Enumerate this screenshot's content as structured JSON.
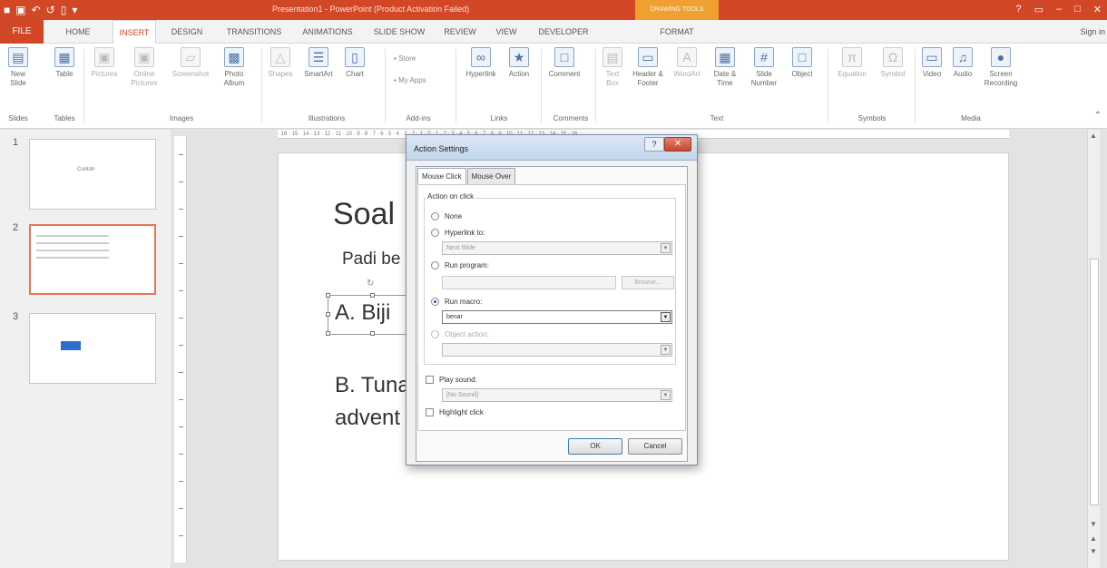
{
  "titlebar": {
    "qat_icons": [
      "powerpoint-logo",
      "save",
      "undo",
      "redo",
      "present-from-start",
      "customize"
    ],
    "title": "Presentation1 - PowerPoint (Product Activation Failed)",
    "context_group": "DRAWING TOOLS",
    "window_controls": [
      "?",
      "▭",
      "–",
      "□",
      "✕"
    ]
  },
  "tabs": {
    "file": "FILE",
    "items": [
      "HOME",
      "INSERT",
      "DESIGN",
      "TRANSITIONS",
      "ANIMATIONS",
      "SLIDE SHOW",
      "REVIEW",
      "VIEW",
      "DEVELOPER",
      "FORMAT"
    ],
    "active": "INSERT",
    "signin": "Sign in"
  },
  "ribbon": {
    "groups": {
      "slides": "Slides",
      "tables": "Tables",
      "images": "Images",
      "illustrations": "Illustrations",
      "addins": "Add-ins",
      "links": "Links",
      "comments": "Comments",
      "text": "Text",
      "symbols": "Symbols",
      "media": "Media"
    },
    "buttons": {
      "new_slide": "New Slide",
      "table": "Table",
      "pictures": "Pictures",
      "online_pictures": "Online Pictures",
      "screenshot": "Screenshot",
      "photo_album": "Photo Album",
      "shapes": "Shapes",
      "smartart": "SmartArt",
      "chart": "Chart",
      "store": "Store",
      "my_apps": "My Apps",
      "hyperlink": "Hyperlink",
      "action": "Action",
      "comment": "Comment",
      "text_box": "Text Box",
      "header_footer": "Header & Footer",
      "wordart": "WordArt",
      "date_time": "Date & Time",
      "slide_number": "Slide Number",
      "object": "Object",
      "equation": "Equation",
      "symbol": "Symbol",
      "video": "Video",
      "audio": "Audio",
      "screen_recording": "Screen Recording"
    }
  },
  "ruler": {
    "h_ticks": "· 16 · 15 · 14 · 13 · 12 · 11 · 10 · 9 · 8 · 7 · 6 · 5 · 4 · 3 · 2 · 1 · 0 · 1 · 2 · 3 · 4 · 5 · 6 · 7 · 8 · 9 · 10 · 11 · 12 · 13 · 14 · 15 · 16"
  },
  "thumbnails": [
    {
      "num": "1",
      "text": "Contoh"
    },
    {
      "num": "2",
      "text": ""
    },
    {
      "num": "3",
      "text": ""
    }
  ],
  "slide": {
    "title": "Soal 1",
    "question": "Padi be",
    "option_a": "A. Biji",
    "option_b_line1": "B. Tuna",
    "option_b_line2": "advent"
  },
  "dialog": {
    "title": "Action Settings",
    "help": "?",
    "close": "✕",
    "tab_mouse_click": "Mouse Click",
    "tab_mouse_over": "Mouse Over",
    "group_label": "Action on click",
    "opt_none": "None",
    "opt_hyperlink": "Hyperlink to:",
    "hyperlink_value": "Next Slide",
    "opt_run_program": "Run program:",
    "browse": "Browse...",
    "opt_run_macro": "Run macro:",
    "macro_value": "benar",
    "opt_object_action": "Object action:",
    "object_action_value": "",
    "play_sound": "Play sound:",
    "sound_value": "[No Sound]",
    "highlight_click": "Highlight click",
    "ok": "OK",
    "cancel": "Cancel"
  }
}
